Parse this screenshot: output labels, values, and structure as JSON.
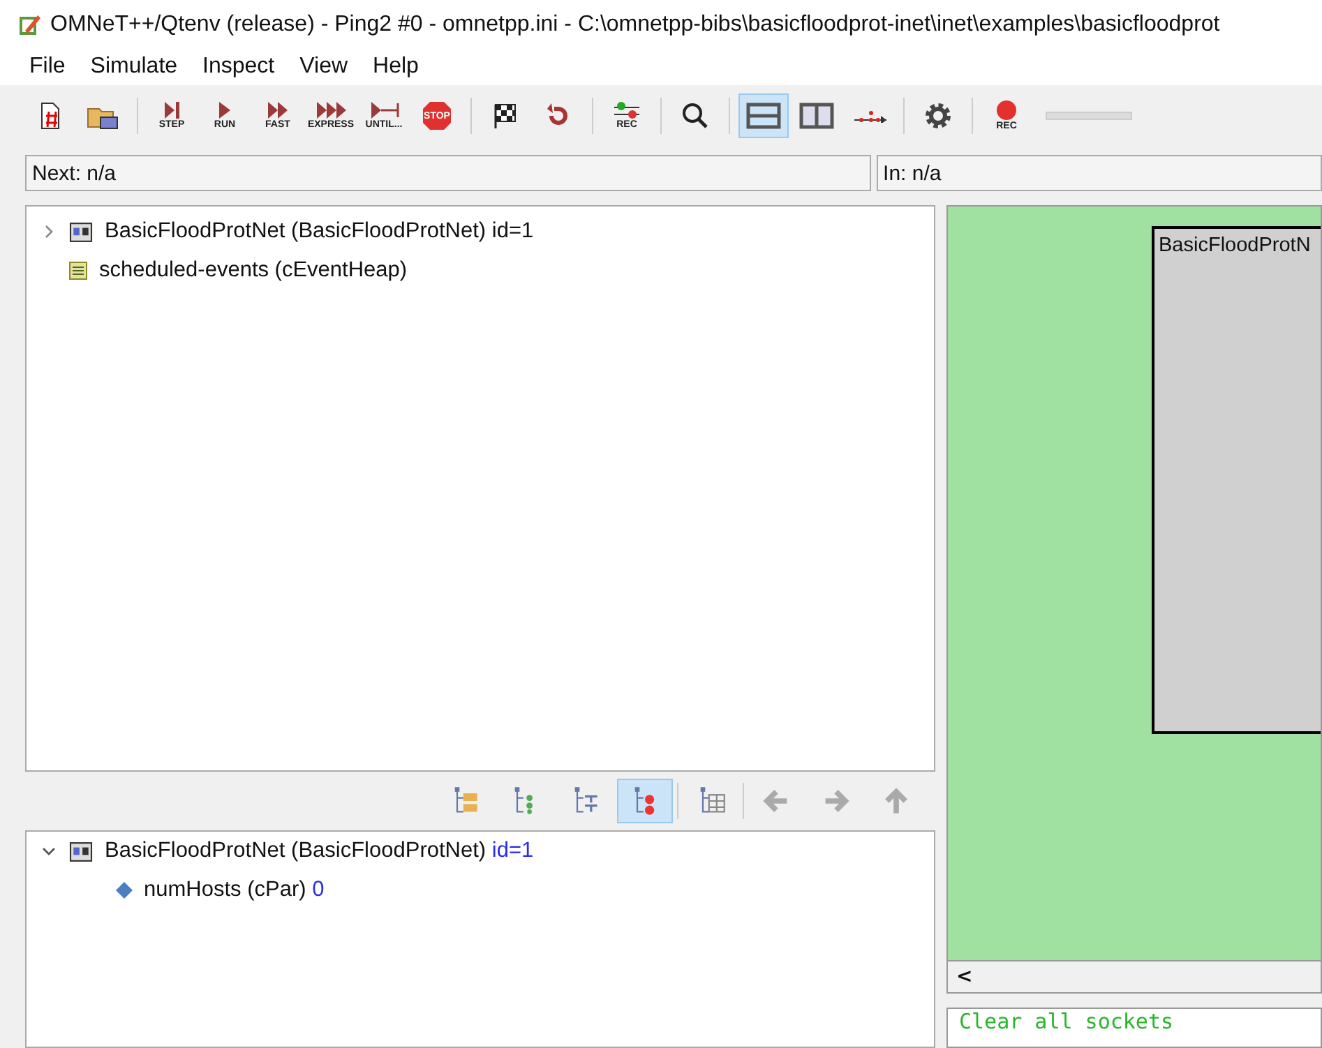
{
  "window": {
    "title": "OMNeT++/Qtenv (release) - Ping2 #0 - omnetpp.ini - C:\\omnetpp-bibs\\basicfloodprot-inet\\inet\\examples\\basicfloodprot"
  },
  "menu": [
    "File",
    "Simulate",
    "Inspect",
    "View",
    "Help"
  ],
  "toolbar": [
    {
      "kind": "new",
      "selected": false
    },
    {
      "kind": "open",
      "selected": false
    },
    {
      "kind": "sep"
    },
    {
      "kind": "step",
      "label": "STEP",
      "selected": false
    },
    {
      "kind": "run",
      "label": "RUN",
      "selected": false
    },
    {
      "kind": "fast",
      "label": "FAST",
      "selected": false
    },
    {
      "kind": "express",
      "label": "EXPRESS",
      "selected": false
    },
    {
      "kind": "until",
      "label": "UNTIL...",
      "selected": false
    },
    {
      "kind": "stop",
      "label": "STOP",
      "selected": false
    },
    {
      "kind": "sep"
    },
    {
      "kind": "finish",
      "selected": false
    },
    {
      "kind": "rebuild",
      "selected": false
    },
    {
      "kind": "sep"
    },
    {
      "kind": "eventrec",
      "label": "REC",
      "selected": false
    },
    {
      "kind": "sep"
    },
    {
      "kind": "find",
      "selected": false
    },
    {
      "kind": "sep"
    },
    {
      "kind": "hsplit",
      "selected": true
    },
    {
      "kind": "vsplit",
      "selected": false
    },
    {
      "kind": "timeline",
      "selected": false
    },
    {
      "kind": "sep"
    },
    {
      "kind": "settings",
      "selected": false
    },
    {
      "kind": "sep"
    },
    {
      "kind": "record",
      "label": "REC",
      "selected": false
    }
  ],
  "speed_slider": {
    "level": 1
  },
  "status": {
    "next": "Next: n/a",
    "in": "In: n/a"
  },
  "object_tree": [
    {
      "label": "BasicFloodProtNet (BasicFloodProtNet) id=1",
      "kind": "network",
      "expanded": false,
      "has_children": true
    },
    {
      "label": "scheduled-events (cEventHeap)",
      "kind": "heap",
      "has_children": false
    }
  ],
  "inspector_toolbar": [
    {
      "kind": "parent",
      "selected": false
    },
    {
      "kind": "children",
      "selected": false
    },
    {
      "kind": "grouped",
      "selected": false
    },
    {
      "kind": "flat",
      "selected": true
    },
    {
      "kind": "sep"
    },
    {
      "kind": "table",
      "selected": false
    },
    {
      "kind": "sep"
    },
    {
      "kind": "back",
      "selected": false
    },
    {
      "kind": "forward",
      "selected": false
    },
    {
      "kind": "up",
      "selected": false
    }
  ],
  "properties": {
    "label": "BasicFloodProtNet (BasicFloodProtNet) ",
    "id": "id=1",
    "expanded": true,
    "children": [
      {
        "label": "numHosts (cPar) ",
        "value": "0"
      }
    ]
  },
  "canvas": {
    "module_label": "BasicFloodProtN",
    "scroll_arrow": "<"
  },
  "log": [
    "Clear all sockets"
  ]
}
